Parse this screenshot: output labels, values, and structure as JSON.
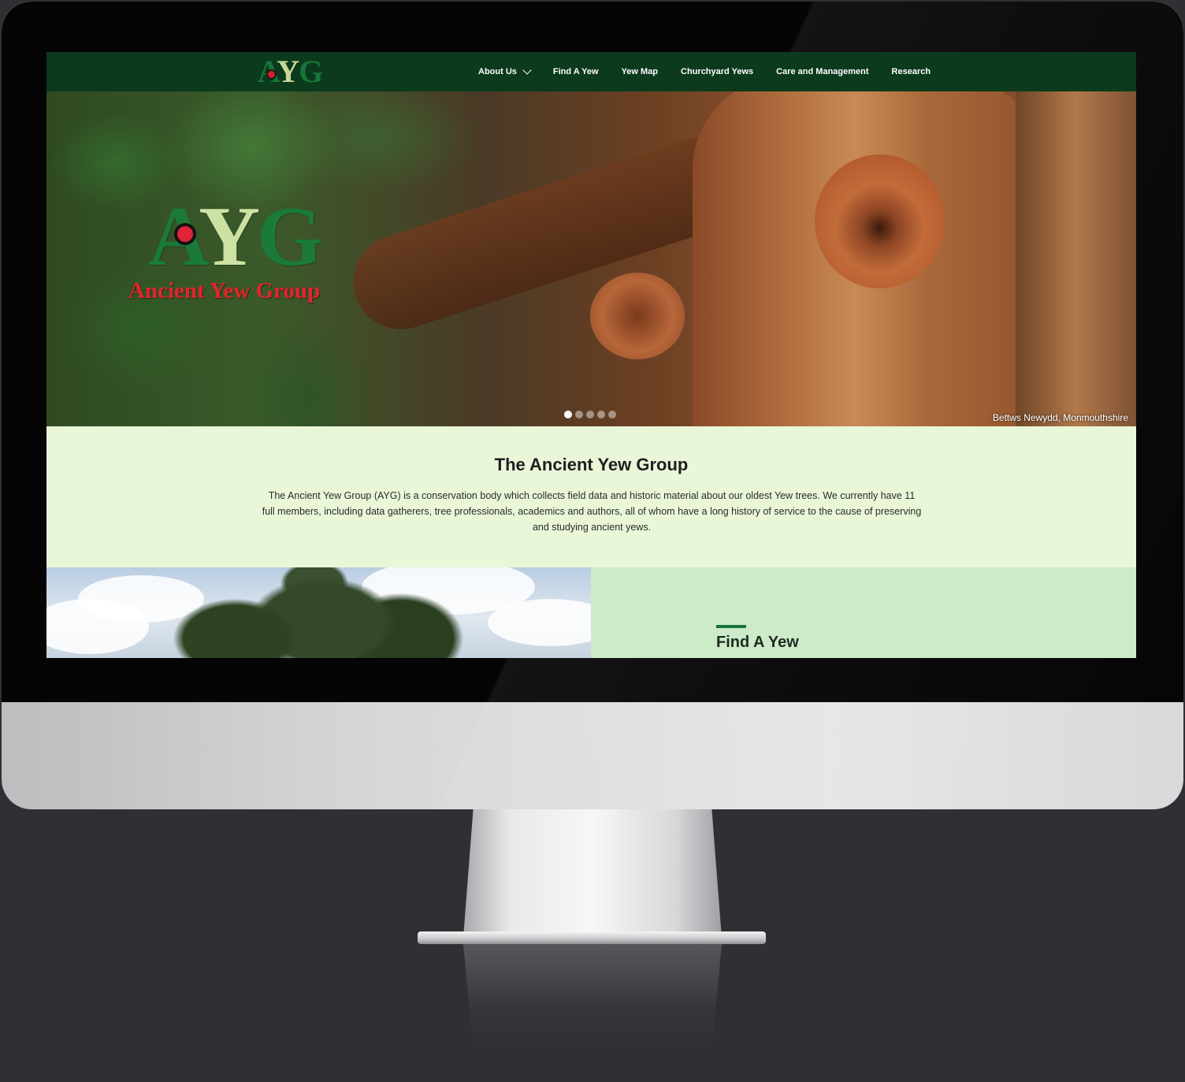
{
  "header": {
    "logo_text": "AYG",
    "nav": [
      {
        "label": "About Us",
        "has_dropdown": true
      },
      {
        "label": "Find A Yew",
        "has_dropdown": false
      },
      {
        "label": "Yew Map",
        "has_dropdown": false
      },
      {
        "label": "Churchyard Yews",
        "has_dropdown": false
      },
      {
        "label": "Care and Management",
        "has_dropdown": false
      },
      {
        "label": "Research",
        "has_dropdown": false
      }
    ]
  },
  "hero": {
    "logo_letters": "AYG",
    "logo_name": "Ancient Yew Group",
    "caption": "Bettws Newydd, Monmouthshire",
    "slide_count": 5,
    "active_slide": 1
  },
  "intro": {
    "title": "The Ancient Yew Group",
    "body": "The Ancient Yew Group (AYG) is a conservation body which collects field data and historic material about our oldest Yew trees. We currently have 11 full members, including data gatherers, tree professionals, academics and authors, all of whom have a long history of service to the cause of preserving and studying ancient yews."
  },
  "feature": {
    "title": "Find A Yew"
  },
  "colors": {
    "header_bg": "#0b3a1c",
    "brand_green": "#16753a",
    "brand_red": "#e3242b",
    "intro_bg": "#e9f6d8",
    "feature_bg": "#cdebc8"
  }
}
